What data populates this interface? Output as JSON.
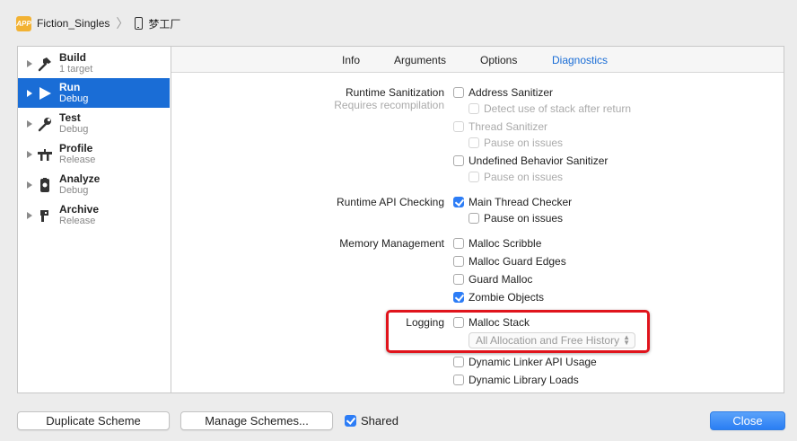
{
  "scheme": {
    "name": "Fiction_Singles",
    "device": "梦工厂"
  },
  "actions": [
    {
      "name": "Build",
      "sub": "1 target",
      "icon": "hammer-icon"
    },
    {
      "name": "Run",
      "sub": "Debug",
      "icon": "play-icon"
    },
    {
      "name": "Test",
      "sub": "Debug",
      "icon": "wrench-icon"
    },
    {
      "name": "Profile",
      "sub": "Release",
      "icon": "instruments-icon"
    },
    {
      "name": "Analyze",
      "sub": "Debug",
      "icon": "analyze-icon"
    },
    {
      "name": "Archive",
      "sub": "Release",
      "icon": "archive-icon"
    }
  ],
  "tabs": [
    "Info",
    "Arguments",
    "Options",
    "Diagnostics"
  ],
  "active_tab": "Diagnostics",
  "sections": {
    "runtime_sanitization": "Runtime Sanitization",
    "runtime_sanitization_sub": "Requires recompilation",
    "runtime_api": "Runtime API Checking",
    "memory": "Memory Management",
    "logging": "Logging"
  },
  "options": {
    "address_sanitizer": "Address Sanitizer",
    "detect_stack": "Detect use of stack after return",
    "thread_sanitizer": "Thread Sanitizer",
    "pause_on_issues": "Pause on issues",
    "undefined_behavior": "Undefined Behavior Sanitizer",
    "main_thread_checker": "Main Thread Checker",
    "malloc_scribble": "Malloc Scribble",
    "malloc_guard_edges": "Malloc Guard Edges",
    "guard_malloc": "Guard Malloc",
    "zombie_objects": "Zombie Objects",
    "malloc_stack": "Malloc Stack",
    "malloc_stack_mode": "All Allocation and Free History",
    "dynamic_linker": "Dynamic Linker API Usage",
    "dynamic_library_loads": "Dynamic Library Loads"
  },
  "buttons": {
    "duplicate": "Duplicate Scheme",
    "manage": "Manage Schemes...",
    "shared": "Shared",
    "close": "Close"
  },
  "colors": {
    "accent": "#1a6dd6",
    "highlight": "#e0141c"
  }
}
